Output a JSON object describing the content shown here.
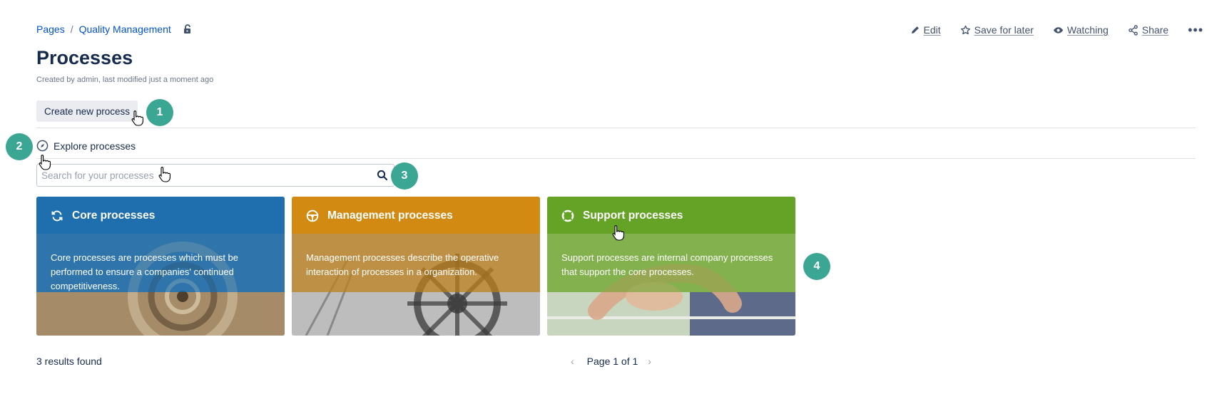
{
  "breadcrumb": {
    "root": "Pages",
    "separator": "/",
    "parent": "Quality Management"
  },
  "actions": {
    "edit": "Edit",
    "save_for_later": "Save for later",
    "watching": "Watching",
    "share": "Share",
    "more": "•••"
  },
  "page": {
    "title": "Processes",
    "meta": "Created by admin, last modified just a moment ago"
  },
  "create_button": "Create new process",
  "explore": {
    "label": "Explore processes"
  },
  "search": {
    "placeholder": "Search for your processes"
  },
  "badges": [
    "1",
    "2",
    "3",
    "4"
  ],
  "cards": [
    {
      "title": "Core processes",
      "description": "Core processes are processes which must be performed to ensure a companies' continued competitiveness.",
      "color": "#1f6fae",
      "icon": "refresh-icon"
    },
    {
      "title": "Management processes",
      "description": "Management processes describe the operative interaction of processes in a organization.",
      "color": "#d38a12",
      "icon": "steering-wheel-icon"
    },
    {
      "title": "Support processes",
      "description": "Support processes are internal company processes that support the core processes.",
      "color": "#64a325",
      "icon": "lifebuoy-icon"
    }
  ],
  "footer": {
    "results": "3 results found",
    "page": "Page 1 of 1",
    "prev": "‹",
    "next": "›"
  },
  "colors": {
    "link": "#0052cc",
    "badge": "#3aa693",
    "text": "#172b4d"
  }
}
